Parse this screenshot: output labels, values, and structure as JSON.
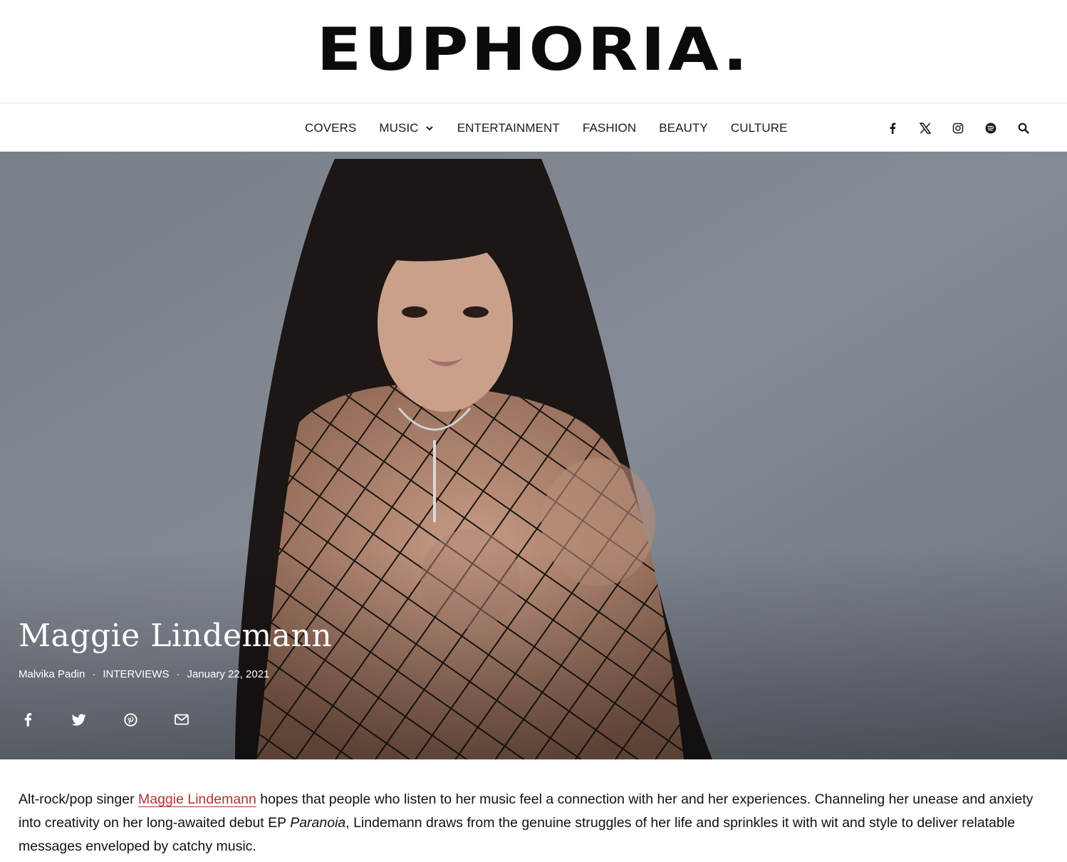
{
  "site": {
    "logo": "EUPHORIA."
  },
  "nav": {
    "items": [
      {
        "label": "COVERS"
      },
      {
        "label": "MUSIC"
      },
      {
        "label": "ENTERTAINMENT"
      },
      {
        "label": "FASHION"
      },
      {
        "label": "BEAUTY"
      },
      {
        "label": "CULTURE"
      }
    ],
    "social_icons": [
      "facebook-icon",
      "x-icon",
      "instagram-icon",
      "spotify-icon",
      "search-icon"
    ]
  },
  "hero": {
    "title": "Maggie Lindemann",
    "author": "Malvika Padin",
    "separator": "·",
    "category": "INTERVIEWS",
    "date": "January 22, 2021",
    "share_icons": [
      "facebook-icon",
      "twitter-icon",
      "pinterest-icon",
      "email-icon"
    ]
  },
  "article": {
    "p1_before": "Alt-rock/pop singer ",
    "p1_link": "Maggie Lindemann",
    "p1_middle": " hopes that people who listen to her music feel a connection with her and her experiences. Channeling her unease and anxiety into creativity on her long-awaited debut EP ",
    "p1_em": "Paranoia",
    "p1_after": ", Lindemann draws from the genuine struggles of her life and sprinkles it with wit and style to deliver relatable messages enveloped by catchy music."
  },
  "colors": {
    "link": "#b03434",
    "hero_bg": "#7e848f",
    "text": "#111111"
  }
}
